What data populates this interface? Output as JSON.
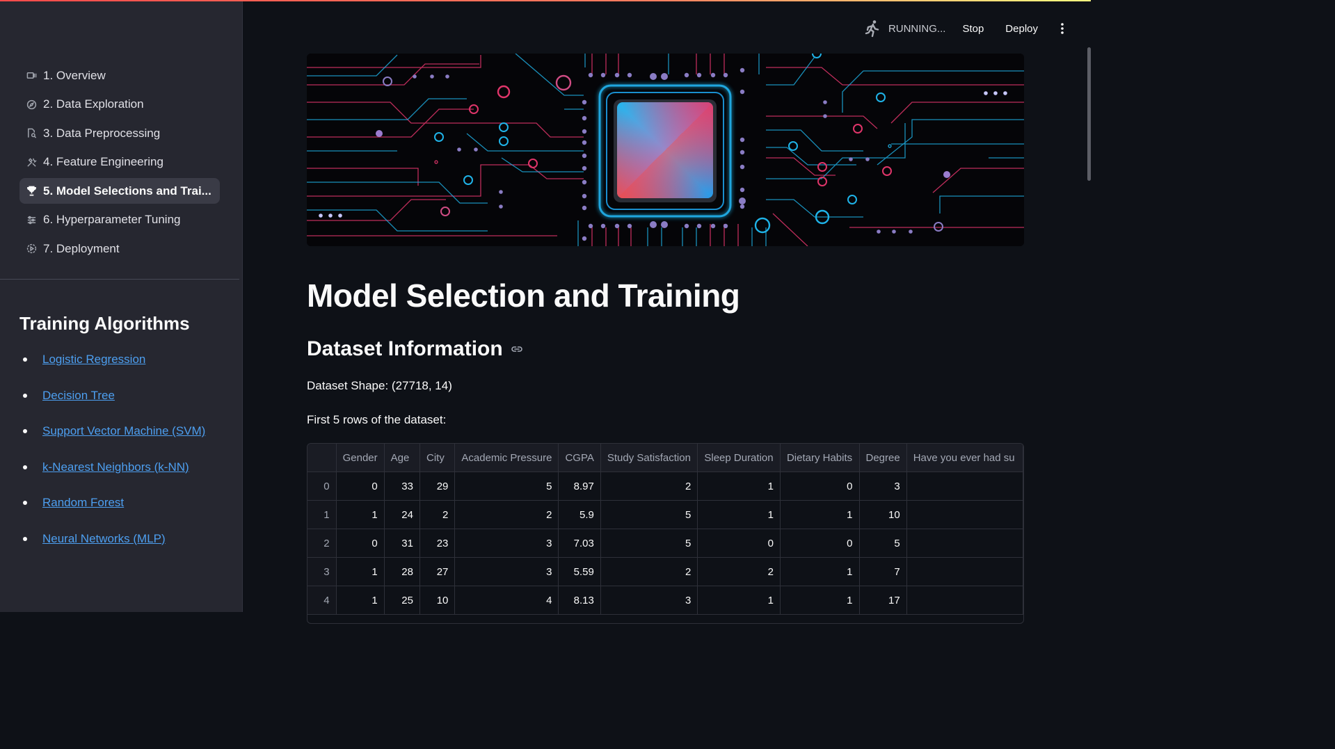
{
  "sidebar": {
    "nav": [
      {
        "label": "1. Overview",
        "icon": "overview-icon"
      },
      {
        "label": "2. Data Exploration",
        "icon": "compass-icon"
      },
      {
        "label": "3. Data Preprocessing",
        "icon": "document-search-icon"
      },
      {
        "label": "4. Feature Engineering",
        "icon": "tools-icon"
      },
      {
        "label": "5. Model Selections and Trai...",
        "icon": "trophy-icon",
        "active": true
      },
      {
        "label": "6. Hyperparameter Tuning",
        "icon": "sliders-icon"
      },
      {
        "label": "7. Deployment",
        "icon": "deploy-icon"
      }
    ],
    "heading": "Training Algorithms",
    "algorithms": [
      "Logistic Regression",
      "Decision Tree",
      "Support Vector Machine (SVM)",
      "k-Nearest Neighbors (k-NN)",
      "Random Forest",
      "Neural Networks (MLP)"
    ]
  },
  "header": {
    "status": "RUNNING...",
    "stop_label": "Stop",
    "deploy_label": "Deploy"
  },
  "main": {
    "title": "Model Selection and Training",
    "section_title": "Dataset Information",
    "shape_text": "Dataset Shape: (27718, 14)",
    "rows_text": "First 5 rows of the dataset:"
  },
  "table": {
    "columns": [
      "",
      "Gender",
      "Age",
      "City",
      "Academic Pressure",
      "CGPA",
      "Study Satisfaction",
      "Sleep Duration",
      "Dietary Habits",
      "Degree",
      "Have you ever had su"
    ],
    "rows": [
      [
        "0",
        "0",
        "33",
        "29",
        "5",
        "8.97",
        "2",
        "1",
        "0",
        "3",
        ""
      ],
      [
        "1",
        "1",
        "24",
        "2",
        "2",
        "5.9",
        "5",
        "1",
        "1",
        "10",
        ""
      ],
      [
        "2",
        "0",
        "31",
        "23",
        "3",
        "7.03",
        "5",
        "0",
        "0",
        "5",
        ""
      ],
      [
        "3",
        "1",
        "28",
        "27",
        "3",
        "5.59",
        "2",
        "2",
        "1",
        "7",
        ""
      ],
      [
        "4",
        "1",
        "25",
        "10",
        "4",
        "8.13",
        "3",
        "1",
        "1",
        "17",
        ""
      ]
    ]
  },
  "colors": {
    "background": "#0e1117",
    "sidebar": "#262730",
    "link": "#4d9ff0",
    "circuit_pink": "#e0356a",
    "circuit_blue": "#1fb3e8"
  }
}
